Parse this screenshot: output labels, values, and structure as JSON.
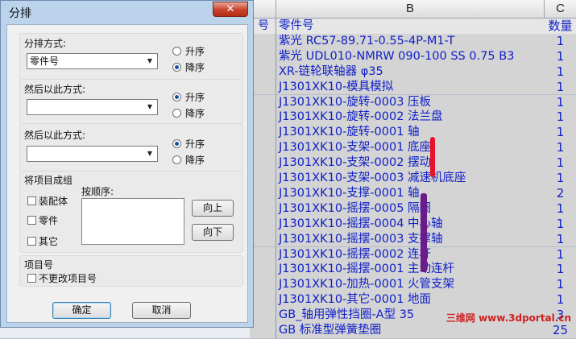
{
  "sheet": {
    "col_headers": [
      "B",
      "C"
    ],
    "rows": [
      {
        "a": "号",
        "b": "零件号",
        "c": "数量"
      },
      {
        "a": "",
        "b": "紫光 RC57-89.71-0.55-4P-M1-T",
        "c": "1"
      },
      {
        "a": "",
        "b": "紫光 UDL010-NMRW 090-100 SS 0.75 B3",
        "c": "1"
      },
      {
        "a": "",
        "b": "XR-链轮联轴器 φ35",
        "c": "1"
      },
      {
        "a": "",
        "b": "J1301XK10-模具模拟",
        "c": "1"
      },
      {
        "a": "",
        "b": "J1301XK10-旋转-0003 压板",
        "c": "1"
      },
      {
        "a": "",
        "b": "J1301XK10-旋转-0002 法兰盘",
        "c": "1"
      },
      {
        "a": "",
        "b": "J1301XK10-旋转-0001 轴",
        "c": "1"
      },
      {
        "a": "",
        "b": "J1301XK10-支架-0001 底座",
        "c": "1"
      },
      {
        "a": "",
        "b": "J1301XK10-支架-0002 摆动",
        "c": "1"
      },
      {
        "a": "",
        "b": "J1301XK10-支架-0003 减速机底座",
        "c": "1"
      },
      {
        "a": "",
        "b": "J1301XK10-支撑-0001 轴",
        "c": "2"
      },
      {
        "a": "",
        "b": "J1301XK10-摇摆-0005 隔圈",
        "c": "1"
      },
      {
        "a": "",
        "b": "J1301XK10-摇摆-0004 中心轴",
        "c": "1"
      },
      {
        "a": "",
        "b": "J1301XK10-摇摆-0003 支撑轴",
        "c": "1"
      },
      {
        "a": "",
        "b": "J1301XK10-摇摆-0002 连杆",
        "c": "1"
      },
      {
        "a": "",
        "b": "J1301XK10-摇摆-0001 主动连杆",
        "c": "1"
      },
      {
        "a": "",
        "b": "J1301XK10-加热-0001 火管支架",
        "c": "1"
      },
      {
        "a": "",
        "b": "J1301XK10-其它-0001 地面",
        "c": "1"
      },
      {
        "a": "",
        "b": "GB_轴用弹性挡圈-A型 35",
        "c": "3"
      },
      {
        "a": "",
        "b": "GB 标准型弹簧垫圈",
        "c": "25"
      }
    ],
    "watermark": "三维网 www.3dportal.cn"
  },
  "dialog": {
    "title": "分排",
    "close_glyph": "✕",
    "sort_by": {
      "label": "分排方式:",
      "value": "零件号",
      "asc": "升序",
      "desc": "降序",
      "selected": "desc"
    },
    "then_by_1": {
      "label": "然后以此方式:",
      "value": "",
      "asc": "升序",
      "desc": "降序",
      "selected": "asc"
    },
    "then_by_2": {
      "label": "然后以此方式:",
      "value": "",
      "asc": "升序",
      "desc": "降序",
      "selected": "asc"
    },
    "group": {
      "label": "将项目成组",
      "assembly": "装配体",
      "part": "零件",
      "other": "其它",
      "order_label": "按顺序:",
      "up": "向上",
      "down": "向下"
    },
    "item_no": {
      "label": "项目号",
      "keep": "不更改项目号"
    },
    "ok": "确定",
    "cancel": "取消"
  },
  "colors": {
    "accent": "#1020c8",
    "close": "#c7412b",
    "marker_red": "#e8122a",
    "marker_purple": "#6a1d8a"
  }
}
